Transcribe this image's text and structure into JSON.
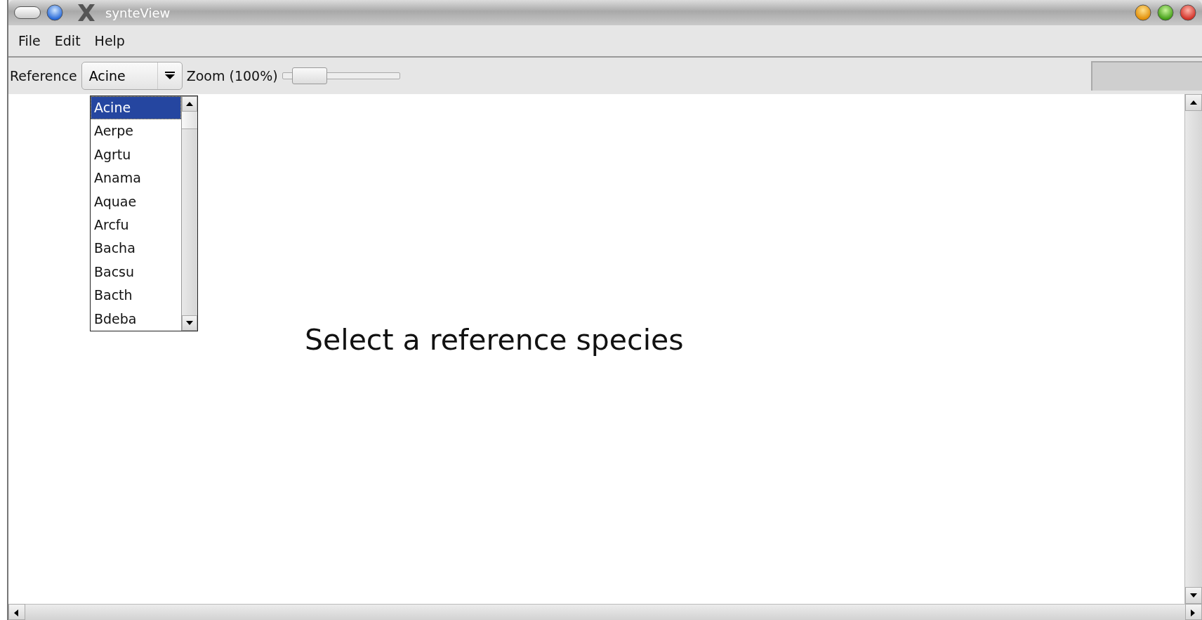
{
  "window": {
    "title": "synteView"
  },
  "menu": [
    "File",
    "Edit",
    "Help"
  ],
  "toolbar": {
    "reference_label": "Reference",
    "reference_value": "Acine",
    "zoom_label": "Zoom (100%)",
    "zoom_slider": {
      "level": 0.12
    }
  },
  "dropdown": {
    "expanded": true,
    "items": [
      {
        "label": "Acine",
        "selected": true
      },
      {
        "label": "Aerpe",
        "selected": false
      },
      {
        "label": "Agrtu",
        "selected": false
      },
      {
        "label": "Anama",
        "selected": false
      },
      {
        "label": "Aquae",
        "selected": false
      },
      {
        "label": "Arcfu",
        "selected": false
      },
      {
        "label": "Bacha",
        "selected": false
      },
      {
        "label": "Bacsu",
        "selected": false
      },
      {
        "label": "Bacth",
        "selected": false
      },
      {
        "label": "Bdeba",
        "selected": false
      }
    ]
  },
  "canvas": {
    "message": "Select a reference species"
  }
}
